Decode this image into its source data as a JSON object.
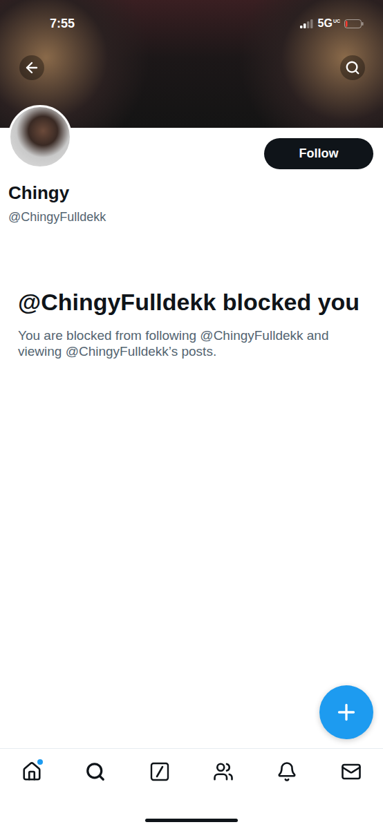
{
  "status_bar": {
    "time": "7:55",
    "network": "5G",
    "network_suffix": "UC",
    "signal": {
      "level": 0.5
    },
    "battery": {
      "level": 0.12,
      "low": true
    }
  },
  "profile": {
    "name": "Chingy",
    "handle": "@ChingyFulldekk",
    "follow_button": "Follow"
  },
  "blocked": {
    "title": "@ChingyFulldekk blocked you",
    "message": "You are blocked from following @ChingyFulldekk and viewing @ChingyFulldekk’s posts."
  },
  "nav": [
    {
      "badge": true
    },
    {
      "badge": false
    },
    {
      "badge": false
    },
    {
      "badge": false
    },
    {
      "badge": false
    },
    {
      "badge": false
    }
  ]
}
